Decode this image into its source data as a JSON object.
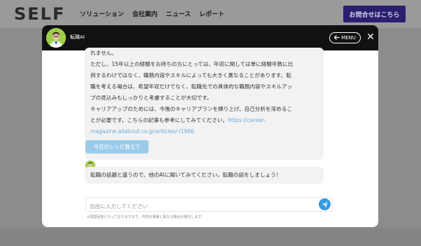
{
  "site": {
    "logo": "SELF",
    "nav": [
      "ソリューション",
      "会社案内",
      "ニュース",
      "レポート"
    ],
    "contact_button": "お問合せはこちら"
  },
  "modal": {
    "title": "転職AI",
    "menu_label": "MENU",
    "close_symbol": "✕",
    "messages": [
      {
        "lines": [
          "れません。",
          "ただし、15年以上の経験をお持ちの方にとっては、年収に関しては単に経験年数に比",
          "例するわけではなく、職務内容やスキルによっても大きく異なることがあります。転",
          "職を考える場合は、希望年収だけでなく、転職先での具体的な職務内容やスキルアッ",
          "プの見込みもしっかりと考慮することが大切です。",
          "キャリアアップのためには、今後のキャリアプランを練り上げ、自己分析を深めるこ",
          "とが必要です。こちらの記事も参考にしてみてください。"
        ],
        "link_part1": "https://career-",
        "link_part2": "magazine.allabout.co.jp/articles/-/1966"
      },
      {
        "text": "転職の話題と違うので、他のAIに聞いてみてください。転職の話をしましょう！"
      }
    ],
    "suggestion": "今日のレシピ教えて",
    "input_placeholder": "自由に入力してください",
    "disclaimer": "※調査回答となっておりますので、内容が事実と異なる場合が発生します。"
  },
  "colors": {
    "accent": "#3a9be0",
    "suggestion_bg": "#9ccbea",
    "header_bg": "#111111",
    "contact_bg": "#2a1f6e"
  },
  "icons": {
    "avatar": "person-avatar-icon",
    "menu_arrow": "back-arrow-icon",
    "close": "close-icon",
    "send": "send-icon"
  }
}
